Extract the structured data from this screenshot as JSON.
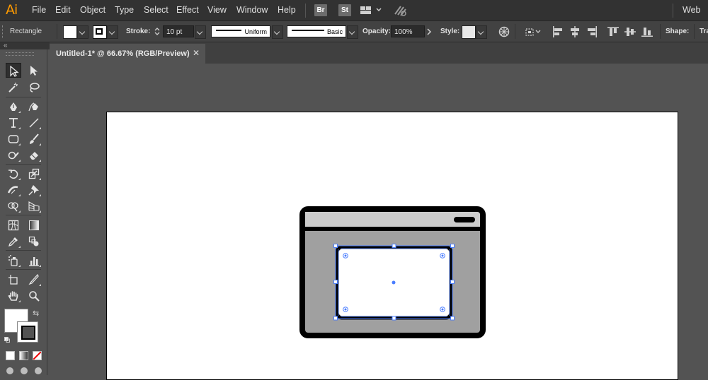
{
  "app": {
    "logo": "Ai",
    "workspace": "Web"
  },
  "menu": [
    "File",
    "Edit",
    "Object",
    "Type",
    "Select",
    "Effect",
    "View",
    "Window",
    "Help"
  ],
  "menubar_badges": {
    "bridge": "Br",
    "stock": "St"
  },
  "control_bar": {
    "selection_type": "Rectangle",
    "stroke_label": "Stroke:",
    "stroke_weight": "10 pt",
    "variable_width_profile": "Uniform",
    "brush_definition": "Basic",
    "opacity_label": "Opacity:",
    "opacity_value": "100%",
    "style_label": "Style:",
    "shape_label": "Shape:",
    "transform_label": "Tra"
  },
  "document_tab": {
    "title": "Untitled-1* @ 66.67% (RGB/Preview)",
    "close_glyph": "✕"
  },
  "colors": {
    "ui_dark": "#323232",
    "panel": "#535353",
    "accent_logo": "#ff9a00",
    "selection": "#4a7dff",
    "artwork_stroke": "#000000",
    "artwork_fill": "#a0a0a0",
    "artwork_header_fill": "#cccccc"
  },
  "tools": [
    "selection-tool",
    "direct-selection-tool",
    "magic-wand-tool",
    "lasso-tool",
    "pen-tool",
    "curvature-tool",
    "type-tool",
    "line-segment-tool",
    "rectangle-tool",
    "paintbrush-tool",
    "shaper-tool",
    "eraser-tool",
    "rotate-tool",
    "scale-tool",
    "width-tool",
    "puppet-warp-tool",
    "shape-builder-tool",
    "perspective-grid-tool",
    "mesh-tool",
    "gradient-tool",
    "eyedropper-tool",
    "blend-tool",
    "symbol-sprayer-tool",
    "column-graph-tool",
    "artboard-tool",
    "slice-tool",
    "hand-tool",
    "zoom-tool"
  ]
}
